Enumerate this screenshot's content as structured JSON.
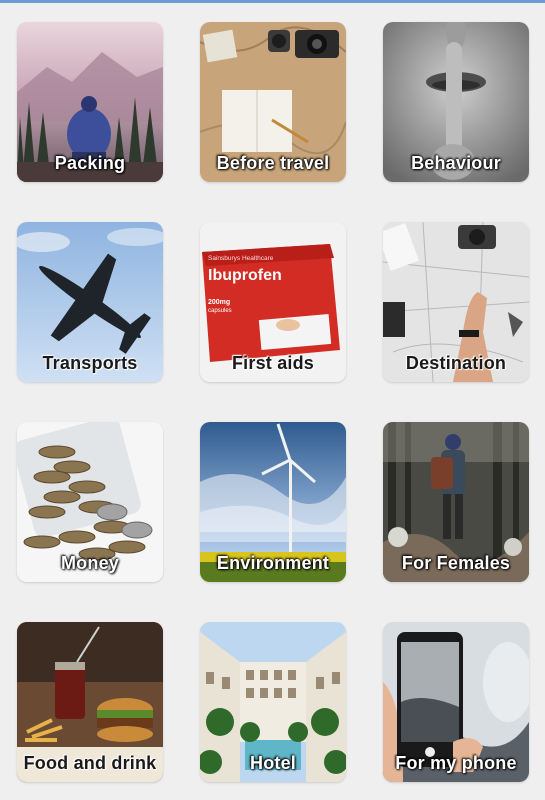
{
  "tiles": [
    {
      "label": "Packing"
    },
    {
      "label": "Before travel"
    },
    {
      "label": "Behaviour"
    },
    {
      "label": "Transports"
    },
    {
      "label": "First aids"
    },
    {
      "label": "Destination"
    },
    {
      "label": "Money"
    },
    {
      "label": "Environment"
    },
    {
      "label": "For Females"
    },
    {
      "label": "Food and drink"
    },
    {
      "label": "Hotel"
    },
    {
      "label": "For my phone"
    }
  ],
  "package_text": {
    "brand": "Sainsburys Healthcare",
    "name": "Ibuprofen",
    "dose": "200mg",
    "form": "capsules"
  },
  "colors": {
    "background": "#efefef",
    "accent_line": "#6e9ad6"
  }
}
